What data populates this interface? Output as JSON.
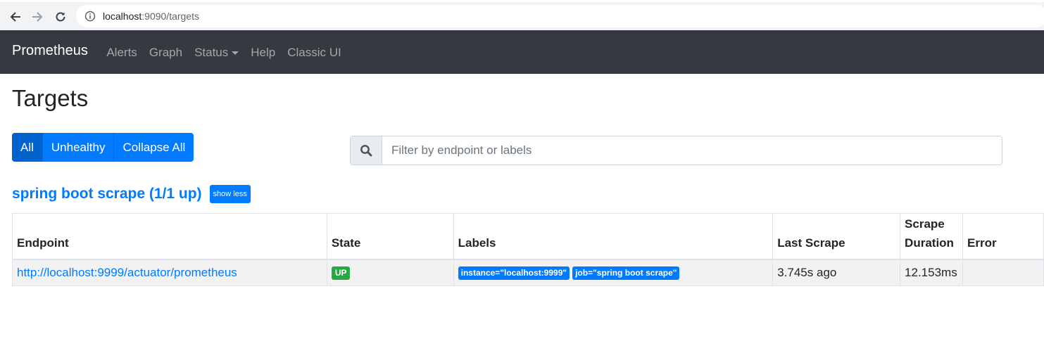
{
  "browser": {
    "url_host": "localhost",
    "url_rest": ":9090/targets"
  },
  "navbar": {
    "brand": "Prometheus",
    "links": [
      {
        "label": "Alerts"
      },
      {
        "label": "Graph"
      },
      {
        "label": "Status"
      },
      {
        "label": "Help"
      },
      {
        "label": "Classic UI"
      }
    ]
  },
  "page": {
    "title": "Targets",
    "filter_buttons": [
      "All",
      "Unhealthy",
      "Collapse All"
    ],
    "active_filter": "All",
    "search_placeholder": "Filter by endpoint or labels"
  },
  "pool": {
    "title": "spring boot scrape (1/1 up)",
    "toggle_label": "show less",
    "columns": [
      "Endpoint",
      "State",
      "Labels",
      "Last Scrape",
      "Scrape Duration",
      "Error"
    ],
    "rows": [
      {
        "endpoint": "http://localhost:9999/actuator/prometheus",
        "state": "UP",
        "labels": [
          "instance=\"localhost:9999\"",
          "job=\"spring boot scrape\""
        ],
        "last_scrape": "3.745s ago",
        "scrape_duration": "12.153ms",
        "error": ""
      }
    ]
  },
  "colors": {
    "navbar_bg": "#343a40",
    "primary": "#007bff",
    "success": "#28a745"
  }
}
